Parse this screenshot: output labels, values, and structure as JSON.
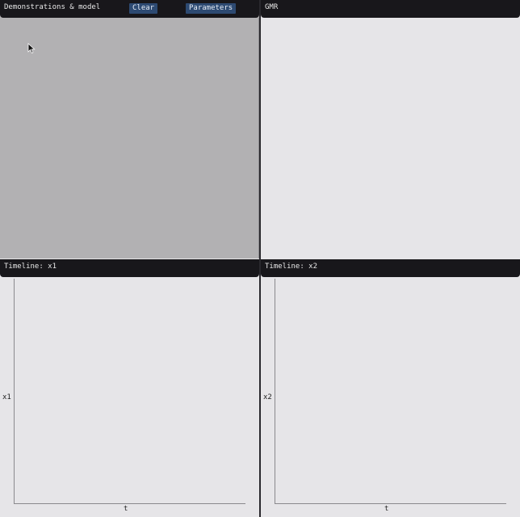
{
  "panels": {
    "demos": {
      "title": "Demonstrations & model",
      "clear_label": "Clear",
      "parameters_label": "Parameters"
    },
    "gmr": {
      "title": "GMR"
    },
    "timeline_x1": {
      "title": "Timeline: x1",
      "xlabel": "t",
      "ylabel": "x1"
    },
    "timeline_x2": {
      "title": "Timeline: x2",
      "xlabel": "t",
      "ylabel": "x2"
    }
  },
  "colors": {
    "titlebar": "#18171b",
    "button": "#2d4a72",
    "demo_canvas": "#b2b1b3",
    "plot_bg": "#e6e5e8"
  },
  "icons": {
    "cursor": "mouse-pointer-icon"
  }
}
